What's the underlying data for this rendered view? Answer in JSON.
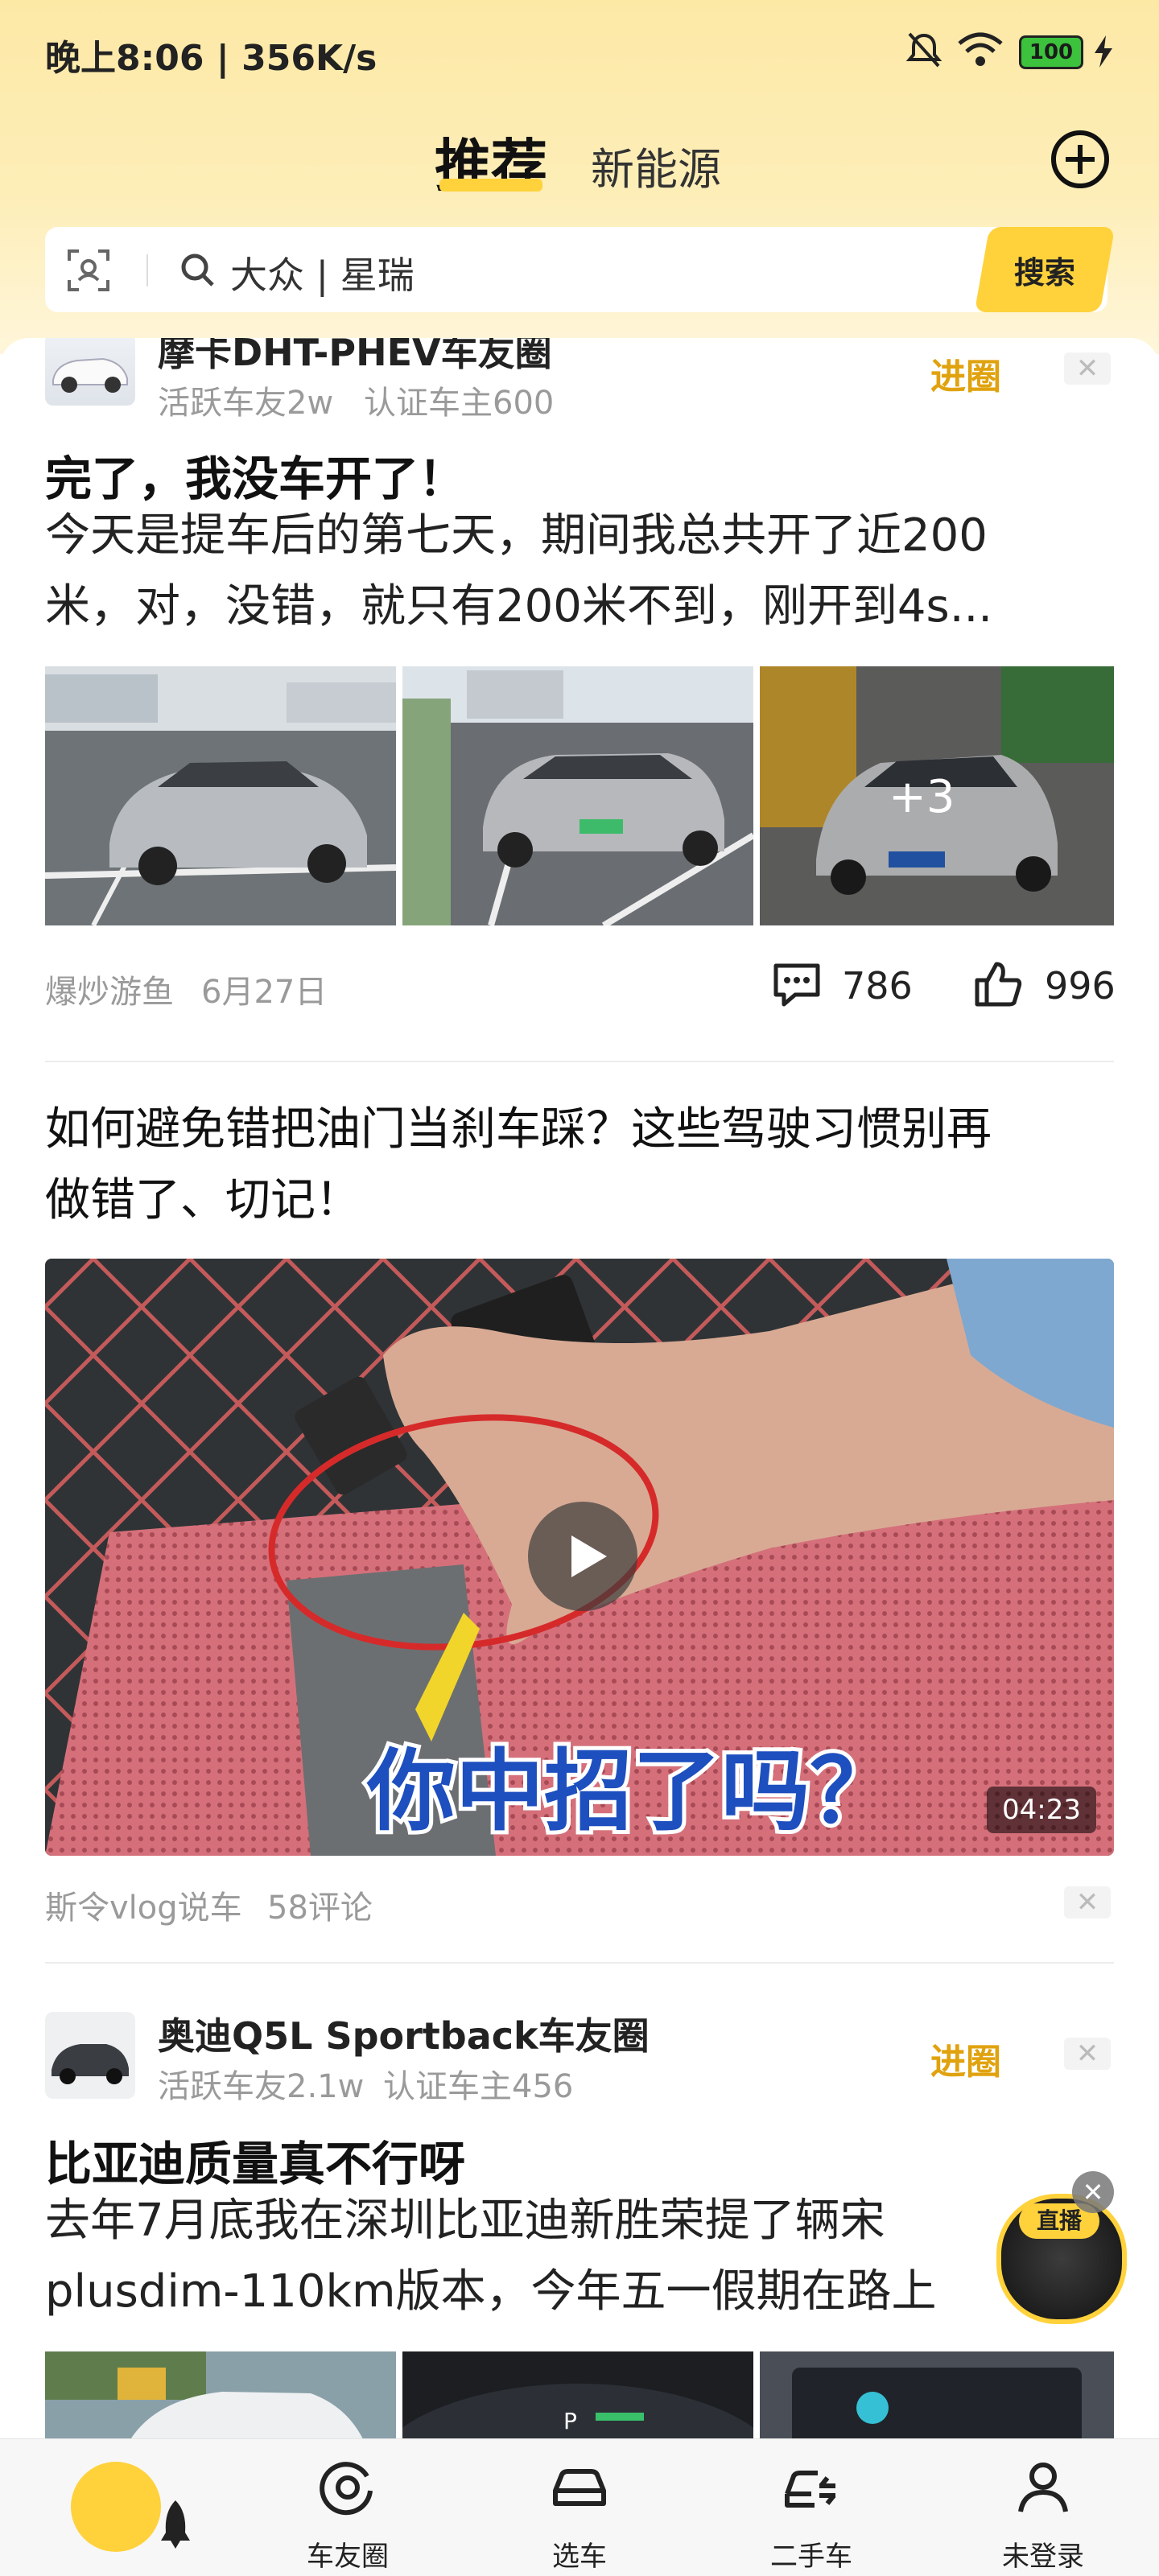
{
  "status_bar": {
    "time_speed": "晚上8:06 | 356K/s",
    "battery": "100"
  },
  "header": {
    "tabs": [
      {
        "label": "推荐",
        "active": true
      },
      {
        "label": "新能源",
        "active": false
      }
    ],
    "search": {
      "placeholder": "大众 | 星瑞",
      "button": "搜索"
    }
  },
  "feed": {
    "post1": {
      "circle_name": "摩卡DHT-PHEV车友圈",
      "active_members": "活跃车友2w",
      "certified_owners": "认证车主600",
      "join_label": "进圈",
      "title": "完了，我没车开了！",
      "excerpt_line1": "今天是提车后的第七天，期间我总共开了近200",
      "excerpt_line2": "米，对，没错，就只有200米不到，刚开到4s...",
      "more_images": "+3",
      "author": "爆炒游鱼",
      "date": "6月27日",
      "comments": "786",
      "likes": "996"
    },
    "post2": {
      "title_line1": "如何避免错把油门当刹车踩？这些驾驶习惯别再",
      "title_line2": "做错了、切记！",
      "video_caption": "你中招了吗？",
      "duration": "04:23",
      "author": "斯令vlog说车",
      "comments": "58评论"
    },
    "post3": {
      "circle_name": "奥迪Q5L Sportback车友圈",
      "active_members": "活跃车友2.1w",
      "certified_owners": "认证车主456",
      "join_label": "进圈",
      "title": "比亚迪质量真不行呀",
      "excerpt_line1": "去年7月底我在深圳比亚迪新胜荣提了辆宋",
      "excerpt_line2": "plusdim-110km版本，今年五一假期在路上"
    },
    "live_badge": "直播"
  },
  "bottom_nav": [
    {
      "label": "",
      "icon": "rocket-icon",
      "active": true
    },
    {
      "label": "车友圈",
      "icon": "target-icon"
    },
    {
      "label": "选车",
      "icon": "car-icon"
    },
    {
      "label": "二手车",
      "icon": "used-car-icon"
    },
    {
      "label": "未登录",
      "icon": "person-icon"
    }
  ],
  "colors": {
    "accent": "#ffd23c",
    "join": "#e0a20e",
    "header_bg": "#fde9a6"
  }
}
